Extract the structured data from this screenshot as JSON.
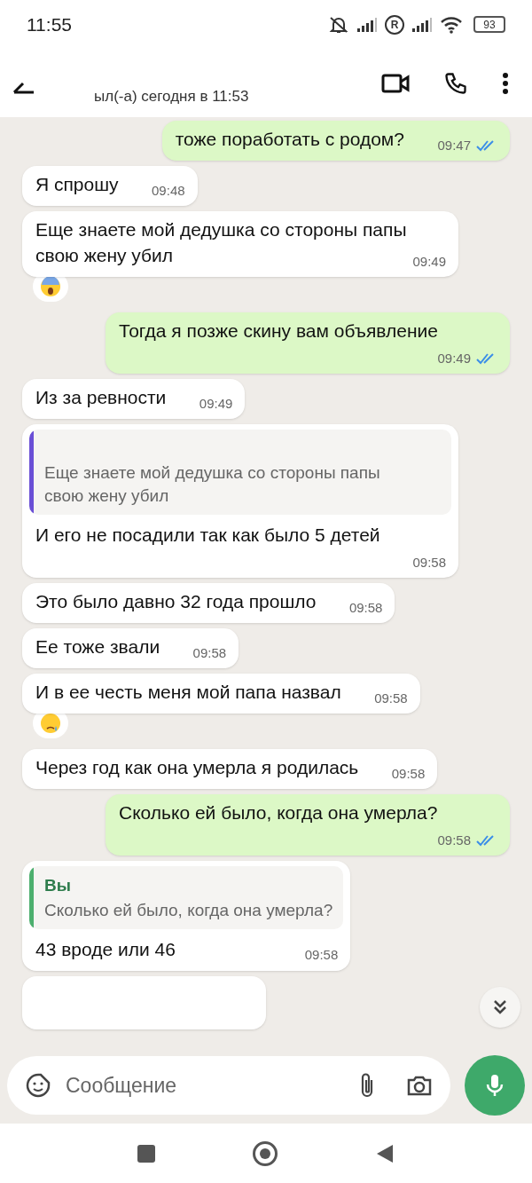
{
  "status_bar": {
    "time": "11:55",
    "battery": "93",
    "roaming": "R"
  },
  "header": {
    "subtitle": "ыл(-а) сегодня в 11:53"
  },
  "messages": [
    {
      "kind": "text",
      "outgoing": true,
      "text": "тоже поработать с родом?",
      "time": "09:47",
      "read": true
    },
    {
      "kind": "text",
      "outgoing": false,
      "text": "Я спрошу",
      "time": "09:48"
    },
    {
      "kind": "text",
      "outgoing": false,
      "text": "Еще знаете мой дедушка со стороны папы свою жену убил",
      "time": "09:49",
      "reaction": {
        "kind": "shocked"
      }
    },
    {
      "kind": "text",
      "outgoing": true,
      "text": "Тогда я позже скину вам объявление",
      "time": "09:49",
      "read": true
    },
    {
      "kind": "text",
      "outgoing": false,
      "text": "Из за ревности",
      "time": "09:49"
    },
    {
      "kind": "reply",
      "outgoing": false,
      "quote": {
        "text": "Еще знаете мой дедушка со стороны папы свою жену убил",
        "color": "#6a4fd6"
      },
      "text": "И его не посадили так как было 5 детей",
      "time": "09:58"
    },
    {
      "kind": "text",
      "outgoing": false,
      "text": "Это было давно 32 года прошло",
      "time": "09:58"
    },
    {
      "kind": "text",
      "outgoing": false,
      "text": "Ее тоже звали",
      "time": "09:58"
    },
    {
      "kind": "text",
      "outgoing": false,
      "text": "И в ее честь меня мой папа назвал",
      "time": "09:58",
      "reaction": {
        "kind": "crying"
      }
    },
    {
      "kind": "text",
      "outgoing": false,
      "text": "Через год как она умерла я родилась",
      "time": "09:58"
    },
    {
      "kind": "text",
      "outgoing": true,
      "text": "Сколько ей было, когда она умерла?",
      "time": "09:58",
      "read": true
    },
    {
      "kind": "reply",
      "outgoing": false,
      "quote": {
        "author": "Вы",
        "text": "Сколько ей было, когда она умерла?",
        "color": "#4caf6e"
      },
      "text": "43 вроде или 46",
      "time": "09:58"
    },
    {
      "kind": "partial",
      "outgoing": false
    }
  ],
  "composer": {
    "placeholder": "Сообщение"
  }
}
